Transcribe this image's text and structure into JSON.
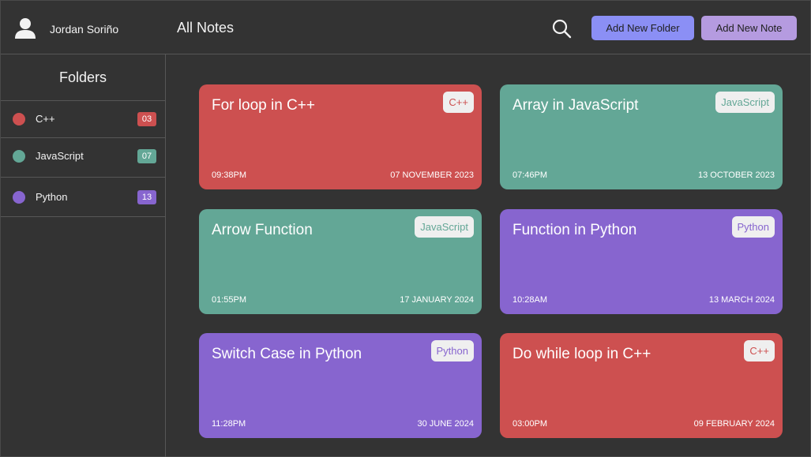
{
  "colors": {
    "background": "#333333",
    "cpp": "#cd5050",
    "javascript": "#63a796",
    "python": "#8765cf",
    "add_folder_button": "#8b8ff5",
    "add_note_button": "#b59be0"
  },
  "header": {
    "user_name": "Jordan Soriño",
    "page_title": "All Notes",
    "add_folder_label": "Add New Folder",
    "add_note_label": "Add New Note",
    "search_icon": "search-icon",
    "avatar_icon": "user-icon"
  },
  "sidebar": {
    "title": "Folders",
    "folders": [
      {
        "label": "C++",
        "count": "03",
        "color": "#cd5050"
      },
      {
        "label": "JavaScript",
        "count": "07",
        "color": "#63a796"
      },
      {
        "label": "Python",
        "count": "13",
        "color": "#8765cf"
      }
    ]
  },
  "notes": [
    {
      "title": "For loop in C++",
      "tag": "C++",
      "time": "09:38PM",
      "date": "07 NOVEMBER 2023",
      "color": "#cd5050"
    },
    {
      "title": "Array in JavaScript",
      "tag": "JavaScript",
      "time": "07:46PM",
      "date": "13 OCTOBER 2023",
      "color": "#63a796"
    },
    {
      "title": "Arrow Function",
      "tag": "JavaScript",
      "time": "01:55PM",
      "date": "17 JANUARY 2024",
      "color": "#63a796"
    },
    {
      "title": "Function in Python",
      "tag": "Python",
      "time": "10:28AM",
      "date": "13 MARCH 2024",
      "color": "#8765cf"
    },
    {
      "title": "Switch Case in Python",
      "tag": "Python",
      "time": "11:28PM",
      "date": "30 JUNE 2024",
      "color": "#8765cf"
    },
    {
      "title": "Do while loop in C++",
      "tag": "C++",
      "time": "03:00PM",
      "date": "09 FEBRUARY 2024",
      "color": "#cd5050"
    }
  ]
}
